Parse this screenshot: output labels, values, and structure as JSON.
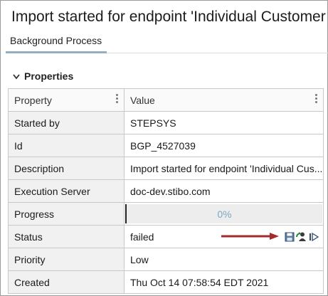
{
  "window": {
    "title": "Import started for endpoint 'Individual Customer I"
  },
  "tabs": [
    {
      "label": "Background Process"
    }
  ],
  "properties": {
    "section_title": "Properties",
    "columns": {
      "property": "Property",
      "value": "Value"
    },
    "rows": [
      {
        "label": "Started by",
        "value": "STEPSYS"
      },
      {
        "label": "Id",
        "value": "BGP_4527039"
      },
      {
        "label": "Description",
        "value": "Import started for endpoint 'Individual Cus..."
      },
      {
        "label": "Execution Server",
        "value": "doc-dev.stibo.com"
      },
      {
        "label": "Progress",
        "value": "0%"
      },
      {
        "label": "Status",
        "value": "failed"
      },
      {
        "label": "Priority",
        "value": "Low"
      },
      {
        "label": "Created",
        "value": "Thu Oct 14 07:58:54 EDT 2021"
      }
    ],
    "progress_fraction": 0
  },
  "status_icons": [
    "save-icon",
    "refresh-user-icon",
    "step-forward-icon"
  ],
  "colors": {
    "arrow": "#a52a2a",
    "progress_text": "#7aa7c7",
    "tab_underline": "#93afc4"
  }
}
